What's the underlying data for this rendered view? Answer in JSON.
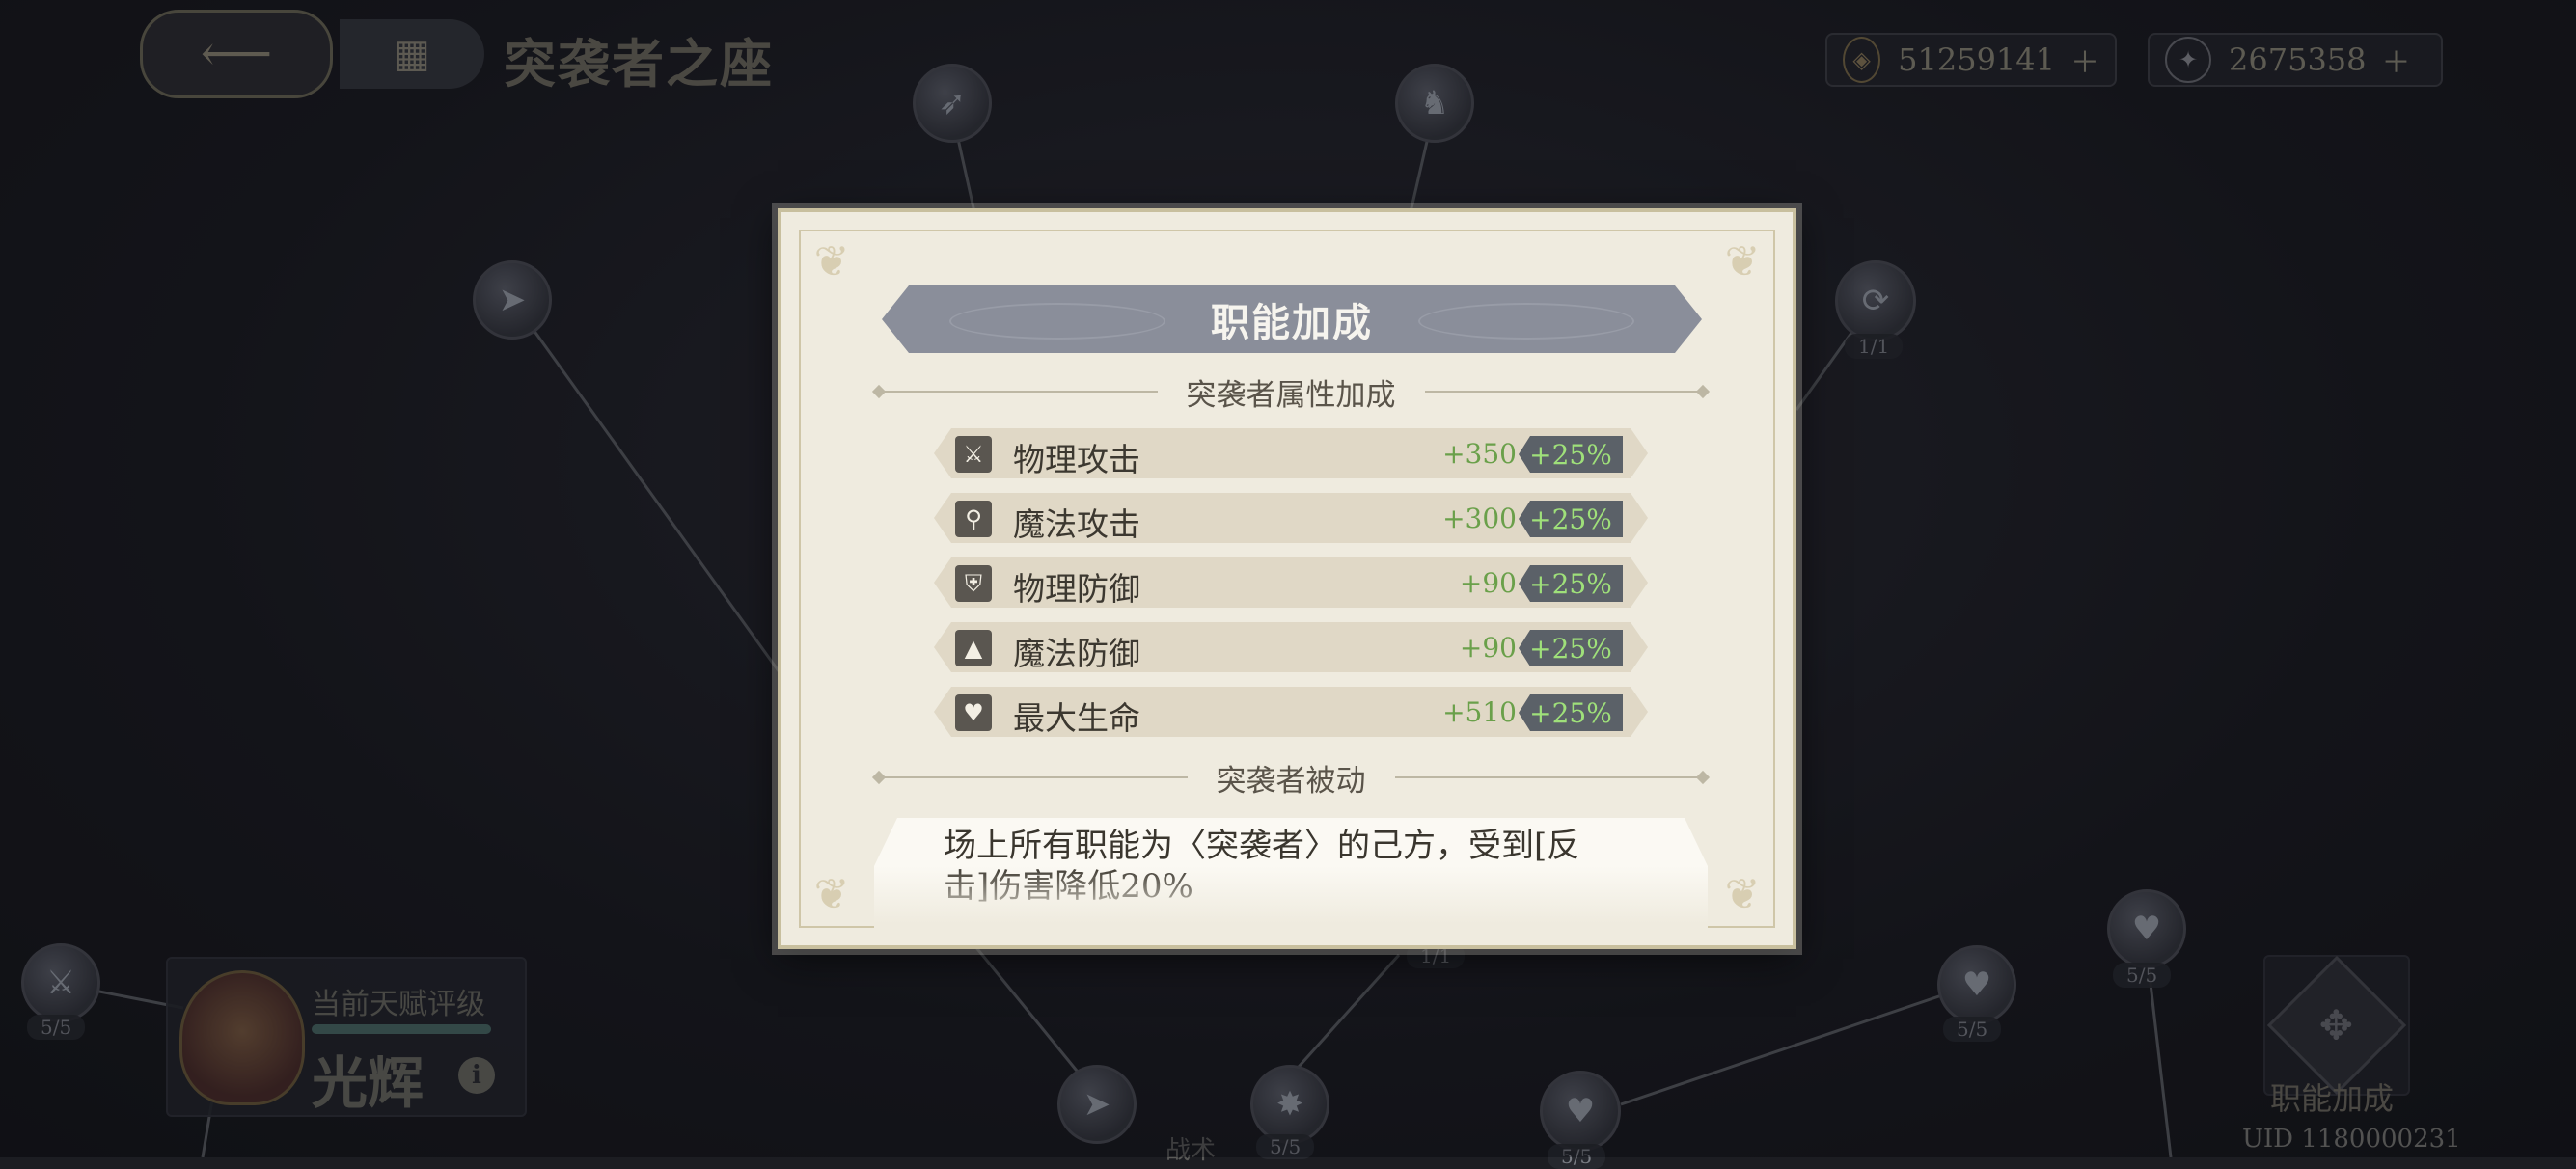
{
  "header": {
    "title": "突袭者之座",
    "back_icon": "back-arrow-icon",
    "menu_icon": "grid-menu-icon"
  },
  "currencies": [
    {
      "icon": "gold-coin-icon",
      "value": "51259141"
    },
    {
      "icon": "crystal-icon",
      "value": "2675358"
    }
  ],
  "talent_tree": {
    "node_counts": [
      "1/1",
      "5/5",
      "1/1",
      "5/5",
      "5/5",
      "5/5",
      "5/5"
    ],
    "bottom_label": "战术"
  },
  "rank": {
    "label": "当前天赋评级",
    "value": "光辉",
    "info_icon": "i"
  },
  "job_bonus_button": {
    "label": "职能加成"
  },
  "uid": "UID 1180000231",
  "modal": {
    "title": "职能加成",
    "attributes_section": "突袭者属性加成",
    "stats": [
      {
        "icon": "sword-icon",
        "glyph": "⚔",
        "name": "物理攻击",
        "value": "+350",
        "percent": "+25%"
      },
      {
        "icon": "staff-icon",
        "glyph": "⚲",
        "name": "魔法攻击",
        "value": "+300",
        "percent": "+25%"
      },
      {
        "icon": "shield-icon",
        "glyph": "⛨",
        "name": "物理防御",
        "value": "+90",
        "percent": "+25%"
      },
      {
        "icon": "wizard-hat-icon",
        "glyph": "▲",
        "name": "魔法防御",
        "value": "+90",
        "percent": "+25%"
      },
      {
        "icon": "heart-icon",
        "glyph": "♥",
        "name": "最大生命",
        "value": "+510",
        "percent": "+25%"
      }
    ],
    "passive_section": "突袭者被动",
    "passive_text": "场上所有职能为〈突袭者〉的己方，受到[反击]伤害降低20%"
  }
}
